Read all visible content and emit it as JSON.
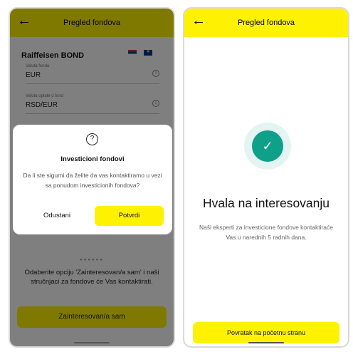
{
  "left_screen": {
    "title": "Pregled fondova",
    "back_icon": "←",
    "fund_name": "Raiffeisen BOND",
    "fields": [
      {
        "label": "Valuta fonda",
        "value": "EUR"
      },
      {
        "label": "Valuta uplate u fond",
        "value": "RSD/EUR"
      }
    ],
    "info_glyph": "i",
    "pager_dots": "●●●●●●",
    "hint": "Odaberite opciju 'Zainteresovan/a sam' i naši stručnjaci za fondove će Vas kontaktirati.",
    "interested_button": "Zainteresovan/a sam",
    "dialog": {
      "icon": "?",
      "title": "Investicioni fondovi",
      "text": "Da li ste sigurni da želite da vas kontaktiramo u vezi sa ponudom investicionih fondova?",
      "cancel_label": "Odustani",
      "confirm_label": "Potvrdi"
    }
  },
  "right_screen": {
    "title": "Pregled fondova",
    "back_icon": "←",
    "check_icon": "✓",
    "thanks_title": "Hvala na interesovanju",
    "thanks_text": "Naši eksperti za investicione fondove kontaktiraće Vas u narednih 5 radnih dana.",
    "home_button": "Povratak na početnu stranu"
  },
  "colors": {
    "accent": "#fef200",
    "success": "#0fa08a",
    "success_halo": "#e3f4f2"
  }
}
